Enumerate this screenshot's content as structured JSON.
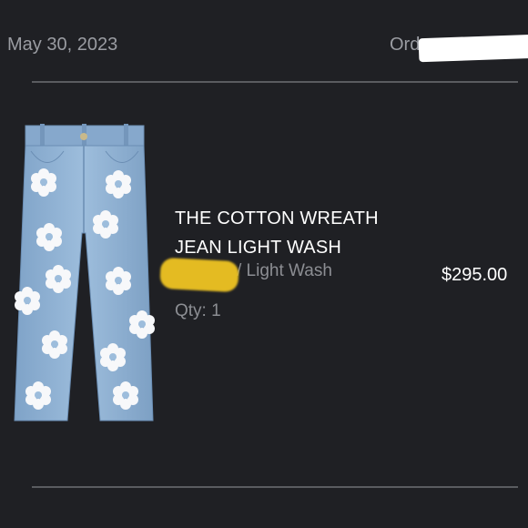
{
  "order": {
    "date": "May 30, 2023",
    "order_label_prefix": "Ord"
  },
  "item": {
    "title_line1": "THE COTTON WREATH",
    "title_line2": "JEAN LIGHT WASH",
    "variant_color": "/ Light Wash",
    "quantity": "Qty: 1",
    "price": "$295.00",
    "image": "jeans-product-image"
  },
  "colors": {
    "background": "#1f2024",
    "muted_text": "#8c8e93",
    "denim": "#8fb1d3",
    "redaction_yellow": "#e4bb22"
  }
}
